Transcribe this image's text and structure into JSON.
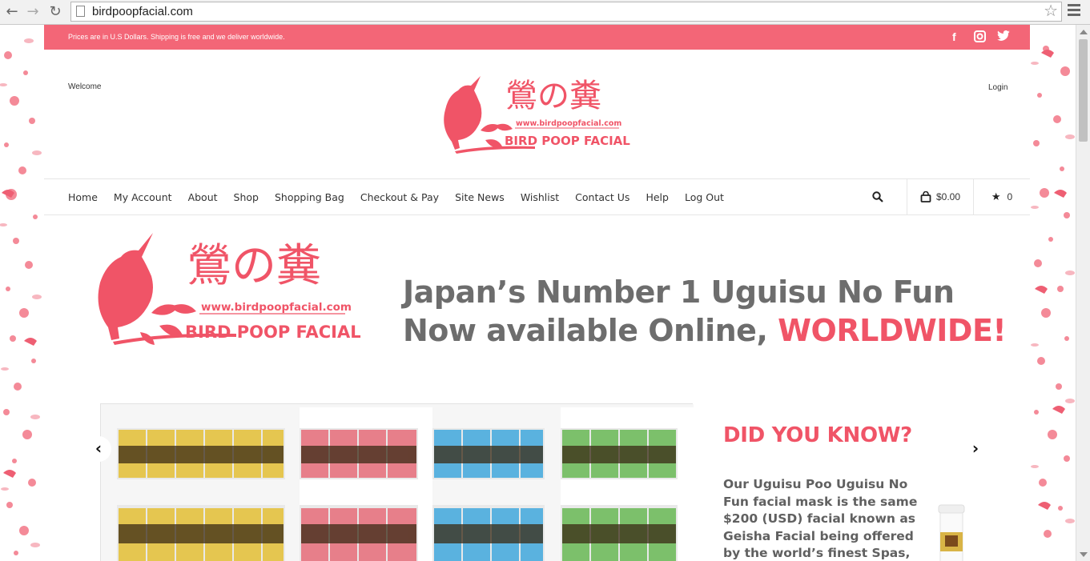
{
  "browser": {
    "url": "birdpoopfacial.com"
  },
  "topbar": {
    "message": "Prices are in U.S Dollars. Shipping is free and we deliver worldwide.",
    "social": [
      {
        "name": "facebook-icon",
        "glyph": "f"
      },
      {
        "name": "instagram-icon",
        "glyph": "◙"
      },
      {
        "name": "twitter-icon",
        "glyph": "🐦"
      }
    ]
  },
  "header": {
    "welcome": "Welcome",
    "login": "Login",
    "logo": {
      "kanji": "鶯の糞",
      "url": "www.birdpoopfacial.com",
      "name": "BIRD POOP FACIAL"
    }
  },
  "nav": {
    "items": [
      "Home",
      "My Account",
      "About",
      "Shop",
      "Shopping Bag",
      "Checkout & Pay",
      "Site News",
      "Wishlist",
      "Contact Us",
      "Help",
      "Log Out"
    ],
    "cart_total": "$0.00",
    "wishlist_count": "0"
  },
  "hero": {
    "headline_line1": "Japan’s Number 1 Uguisu No Fun",
    "headline_line2_prefix": "Now available Online, ",
    "headline_line2_accent": "WORLDWIDE!"
  },
  "slide": {
    "title": "DID YOU KNOW?",
    "body": "Our Uguisu Poo Uguisu No Fun facial mask is the same $200 (USD) facial known as Geisha Facial being offered by the world’s finest Spas, Aesthetic Centers and"
  },
  "colors": {
    "brand_pink": "#f36677",
    "accent_red": "#f05467",
    "headline_gray": "#6d6d6d"
  }
}
